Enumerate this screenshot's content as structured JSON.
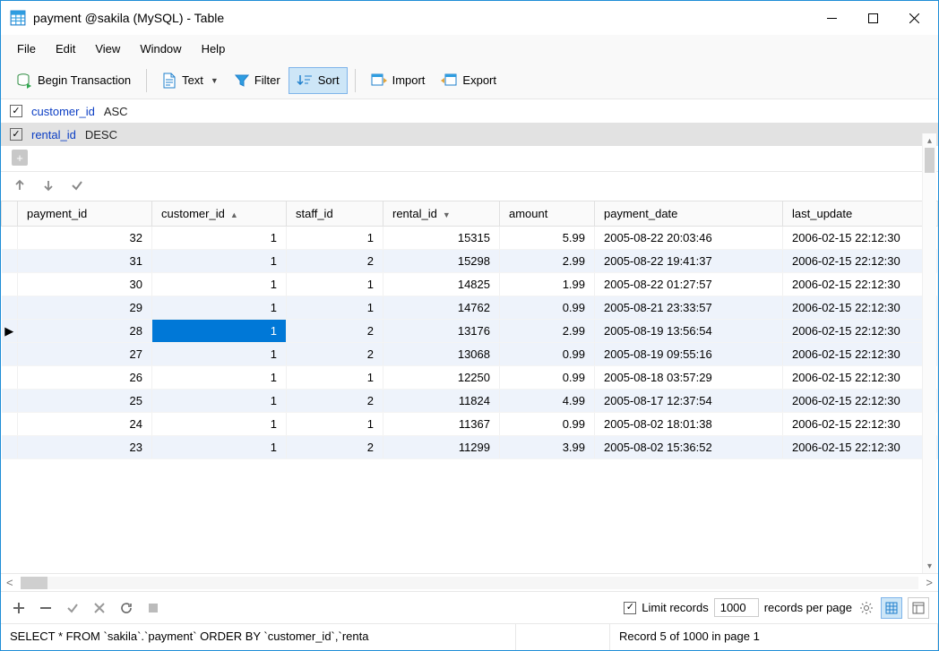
{
  "window": {
    "title": "payment @sakila (MySQL) - Table"
  },
  "menu": {
    "items": [
      "File",
      "Edit",
      "View",
      "Window",
      "Help"
    ]
  },
  "toolbar": {
    "begin_transaction": "Begin Transaction",
    "text": "Text",
    "filter": "Filter",
    "sort": "Sort",
    "import": "Import",
    "export": "Export"
  },
  "sort": {
    "rules": [
      {
        "field": "customer_id",
        "direction": "ASC",
        "enabled": true
      },
      {
        "field": "rental_id",
        "direction": "DESC",
        "enabled": true
      }
    ]
  },
  "columns": [
    "payment_id",
    "customer_id",
    "staff_id",
    "rental_id",
    "amount",
    "payment_date",
    "last_update"
  ],
  "rows": [
    {
      "payment_id": 32,
      "customer_id": 1,
      "staff_id": 1,
      "rental_id": 15315,
      "amount": "5.99",
      "payment_date": "2005-08-22 20:03:46",
      "last_update": "2006-02-15 22:12:30"
    },
    {
      "payment_id": 31,
      "customer_id": 1,
      "staff_id": 2,
      "rental_id": 15298,
      "amount": "2.99",
      "payment_date": "2005-08-22 19:41:37",
      "last_update": "2006-02-15 22:12:30"
    },
    {
      "payment_id": 30,
      "customer_id": 1,
      "staff_id": 1,
      "rental_id": 14825,
      "amount": "1.99",
      "payment_date": "2005-08-22 01:27:57",
      "last_update": "2006-02-15 22:12:30"
    },
    {
      "payment_id": 29,
      "customer_id": 1,
      "staff_id": 1,
      "rental_id": 14762,
      "amount": "0.99",
      "payment_date": "2005-08-21 23:33:57",
      "last_update": "2006-02-15 22:12:30"
    },
    {
      "payment_id": 28,
      "customer_id": 1,
      "staff_id": 2,
      "rental_id": 13176,
      "amount": "2.99",
      "payment_date": "2005-08-19 13:56:54",
      "last_update": "2006-02-15 22:12:30"
    },
    {
      "payment_id": 27,
      "customer_id": 1,
      "staff_id": 2,
      "rental_id": 13068,
      "amount": "0.99",
      "payment_date": "2005-08-19 09:55:16",
      "last_update": "2006-02-15 22:12:30"
    },
    {
      "payment_id": 26,
      "customer_id": 1,
      "staff_id": 1,
      "rental_id": 12250,
      "amount": "0.99",
      "payment_date": "2005-08-18 03:57:29",
      "last_update": "2006-02-15 22:12:30"
    },
    {
      "payment_id": 25,
      "customer_id": 1,
      "staff_id": 2,
      "rental_id": 11824,
      "amount": "4.99",
      "payment_date": "2005-08-17 12:37:54",
      "last_update": "2006-02-15 22:12:30"
    },
    {
      "payment_id": 24,
      "customer_id": 1,
      "staff_id": 1,
      "rental_id": 11367,
      "amount": "0.99",
      "payment_date": "2005-08-02 18:01:38",
      "last_update": "2006-02-15 22:12:30"
    },
    {
      "payment_id": 23,
      "customer_id": 1,
      "staff_id": 2,
      "rental_id": 11299,
      "amount": "3.99",
      "payment_date": "2005-08-02 15:36:52",
      "last_update": "2006-02-15 22:12:30"
    }
  ],
  "selected_row_index": 4,
  "footer": {
    "limit_label": "Limit records",
    "limit_value": "1000",
    "per_page_label": "records per page"
  },
  "status": {
    "sql": "SELECT * FROM `sakila`.`payment` ORDER BY `customer_id`,`renta",
    "record": "Record 5 of 1000 in page 1"
  }
}
